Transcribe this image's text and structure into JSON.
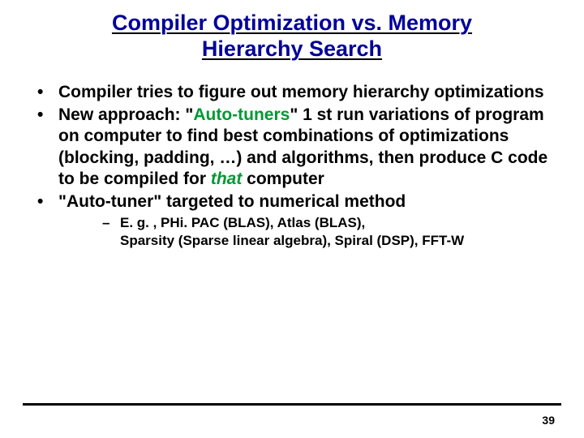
{
  "title": {
    "line1": "Compiler Optimization vs. Memory",
    "line2": "Hierarchy Search"
  },
  "bullets": [
    {
      "pre": "Compiler tries to figure out memory hierarchy optimizations"
    },
    {
      "pre": "New approach: \"",
      "accent": "Auto-tuners",
      "mid": "\" 1 st run variations of program on computer to find best combinations of optimizations (blocking, padding, …) and algorithms, then produce C code to be compiled for ",
      "accent2": "that",
      "post": " computer"
    },
    {
      "pre": "\"Auto-tuner\" targeted to numerical method"
    }
  ],
  "sub": {
    "line1": "E. g. , PHi. PAC (BLAS), Atlas (BLAS),",
    "line2": "Sparsity (Sparse linear algebra), Spiral (DSP), FFT-W"
  },
  "page_number": "39"
}
